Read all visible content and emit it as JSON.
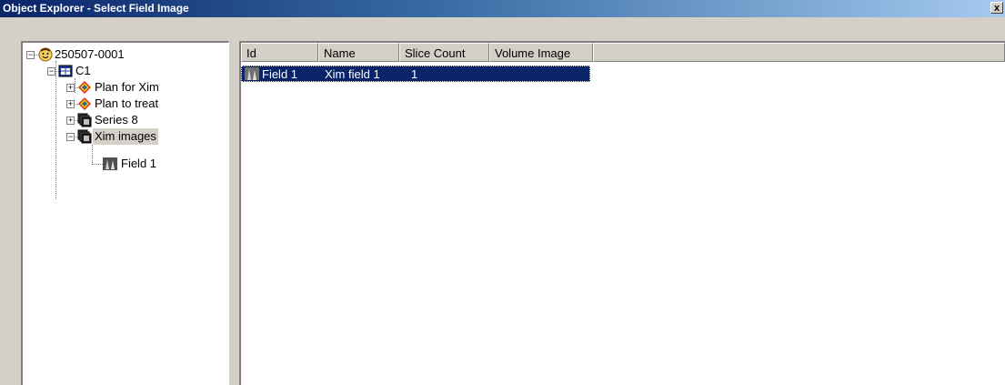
{
  "window": {
    "title": "Object Explorer - Select Field Image",
    "close_label": "x"
  },
  "tree": {
    "items": [
      {
        "label": "250507-0001",
        "icon": "patient-icon",
        "expander": "−"
      },
      {
        "label": "C1",
        "icon": "course-icon",
        "expander": "−"
      },
      {
        "label": "Plan for Xim",
        "icon": "plan-icon",
        "expander": "+"
      },
      {
        "label": "Plan to treat",
        "icon": "plan-icon",
        "expander": "+"
      },
      {
        "label": "Series 8",
        "icon": "series-icon",
        "expander": "+"
      },
      {
        "label": "Xim images",
        "icon": "series-icon",
        "expander": "−",
        "selected": true
      },
      {
        "label": "Field 1",
        "icon": "field-image-icon"
      }
    ]
  },
  "list": {
    "columns": [
      "Id",
      "Name",
      "Slice Count",
      "Volume Image"
    ],
    "rows": [
      {
        "id": "Field 1",
        "name": "Xim field 1",
        "slice_count": "1",
        "volume_image": "",
        "selected": true
      }
    ]
  },
  "colors": {
    "selection": "#0a246a",
    "title_gradient_start": "#0a246a",
    "title_gradient_end": "#a6caf0",
    "window_bg": "#d4d0c8"
  }
}
